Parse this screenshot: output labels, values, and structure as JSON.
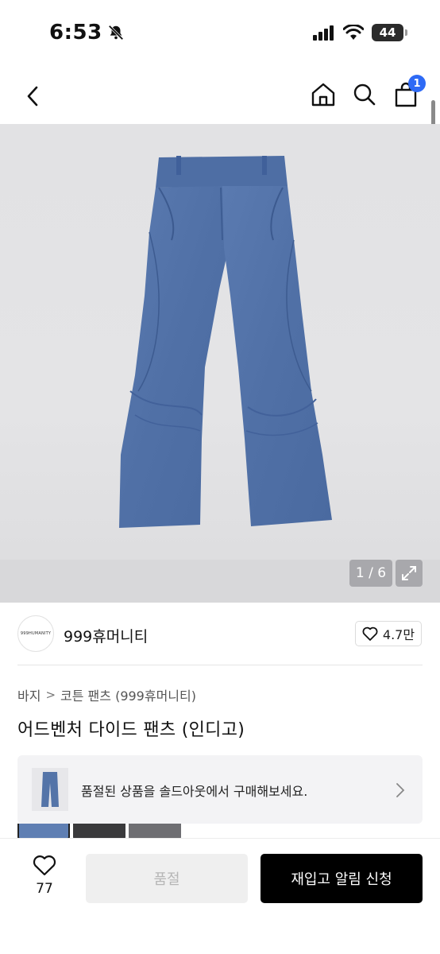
{
  "status_bar": {
    "time": "6:53",
    "battery": "44"
  },
  "header": {
    "cart_count": "1"
  },
  "image": {
    "counter": "1 / 6"
  },
  "brand": {
    "logo_text": "999HUMANITY",
    "name": "999휴머니티",
    "likes": "4.7만"
  },
  "breadcrumb": {
    "items": [
      "바지",
      "코튼 팬츠 (999휴머니티)"
    ]
  },
  "product": {
    "title": "어드벤처 다이드 팬츠 (인디고)"
  },
  "soldout_banner": {
    "text": "품절된 상품을 솔드아웃에서 구매해보세요."
  },
  "bottom_bar": {
    "wish_count": "77",
    "soldout_label": "품절",
    "restock_label": "재입고 알림 신청"
  },
  "colors": {
    "accent_badge": "#2e6af5",
    "pants_indigo": "#5474a8",
    "cta": "#000000"
  }
}
